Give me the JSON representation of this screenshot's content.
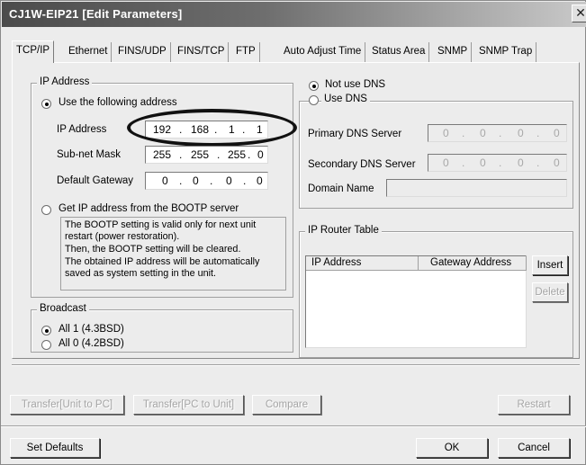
{
  "window": {
    "title": "CJ1W-EIP21 [Edit Parameters]",
    "close_glyph": "✕"
  },
  "tabs": [
    {
      "label": "TCP/IP",
      "active": true
    },
    {
      "label": "Ethernet"
    },
    {
      "label": "FINS/UDP"
    },
    {
      "label": "FINS/TCP"
    },
    {
      "label": "FTP"
    },
    {
      "label": "Auto Adjust Time"
    },
    {
      "label": "Status Area"
    },
    {
      "label": "SNMP"
    },
    {
      "label": "SNMP Trap"
    }
  ],
  "ip_address_group": {
    "title": "IP Address",
    "use_following_label": "Use the following address",
    "use_following_selected": true,
    "ip_label": "IP Address",
    "ip_value": [
      "192",
      "168",
      "1",
      "1"
    ],
    "subnet_label": "Sub-net Mask",
    "subnet_value": [
      "255",
      "255",
      "255",
      "0"
    ],
    "gateway_label": "Default Gateway",
    "gateway_value": [
      "0",
      "0",
      "0",
      "0"
    ],
    "bootp_label": "Get IP address from the BOOTP server",
    "bootp_selected": false,
    "bootp_note": [
      "The BOOTP setting is valid only for next unit",
      "restart (power restoration).",
      "Then, the BOOTP setting will be cleared.",
      "The obtained IP address will be automatically",
      "saved as system setting in the unit."
    ]
  },
  "broadcast_group": {
    "title": "Broadcast",
    "options": [
      {
        "label": "All 1 (4.3BSD)",
        "selected": true
      },
      {
        "label": "All 0 (4.2BSD)",
        "selected": false
      }
    ]
  },
  "dns": {
    "not_use_label": "Not use DNS",
    "not_use_selected": true,
    "use_label": "Use DNS",
    "use_selected": false,
    "primary_label": "Primary DNS Server",
    "primary_value": [
      "0",
      "0",
      "0",
      "0"
    ],
    "secondary_label": "Secondary DNS Server",
    "secondary_value": [
      "0",
      "0",
      "0",
      "0"
    ],
    "domain_label": "Domain Name",
    "domain_value": ""
  },
  "ip_router_table": {
    "title": "IP Router Table",
    "columns": [
      "IP Address",
      "Gateway Address"
    ],
    "rows": [],
    "insert_label": "Insert",
    "delete_label": "Delete"
  },
  "transfer_bar": {
    "transfer_unit_to_pc": "Transfer[Unit to PC]",
    "transfer_pc_to_unit": "Transfer[PC to Unit]",
    "compare": "Compare",
    "restart": "Restart"
  },
  "footer": {
    "set_defaults": "Set Defaults",
    "ok": "OK",
    "cancel": "Cancel"
  }
}
